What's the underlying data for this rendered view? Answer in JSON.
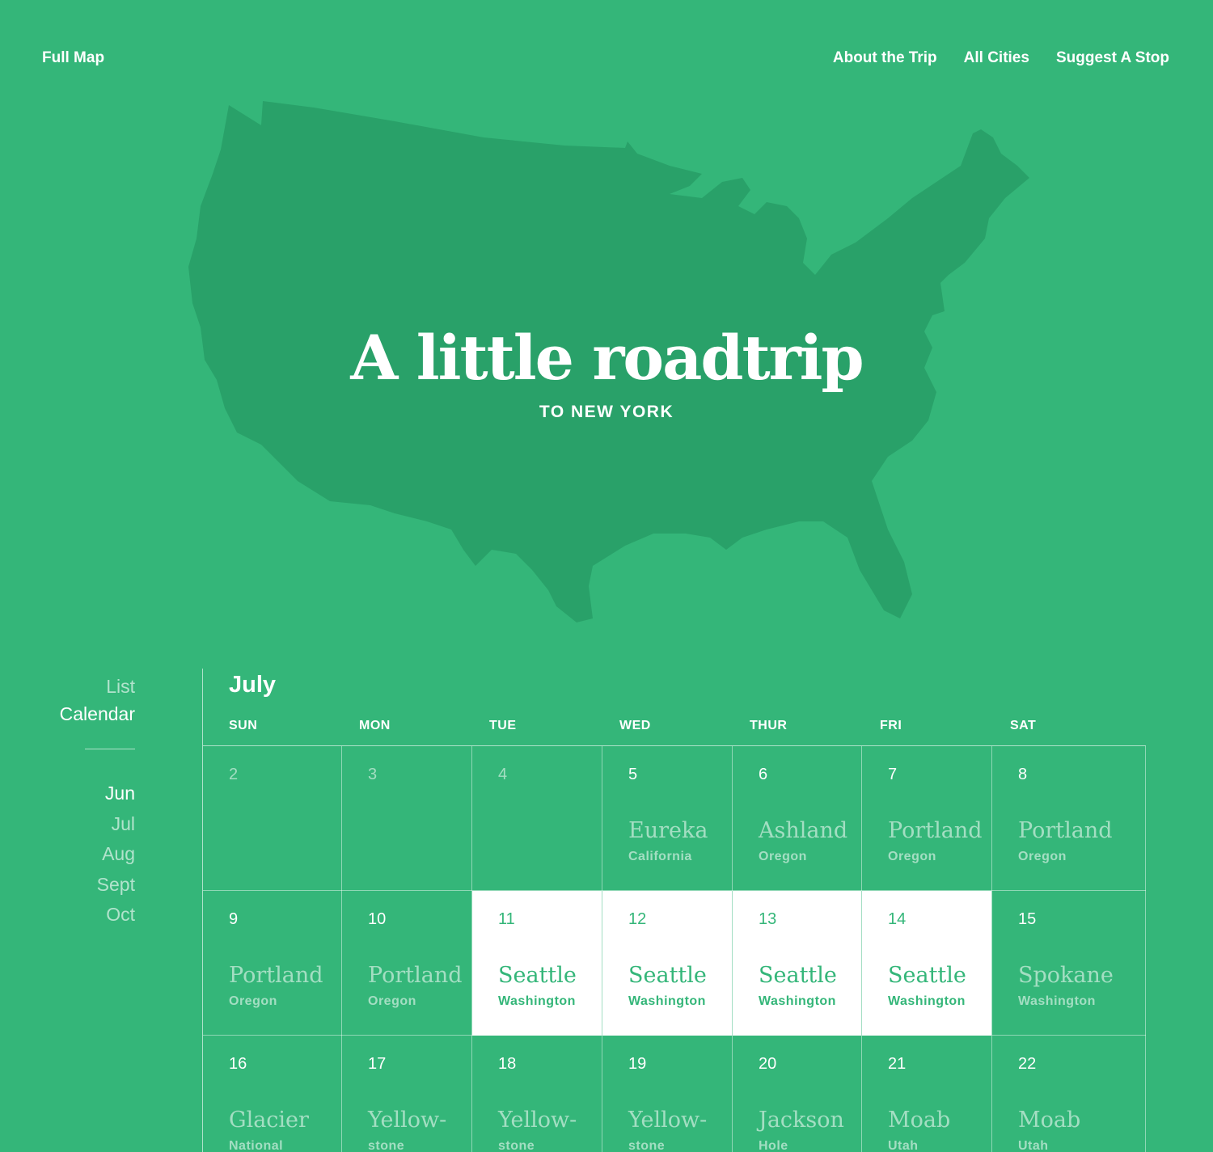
{
  "topnav": {
    "full_map": "Full Map",
    "about": "About the Trip",
    "cities": "All Cities",
    "suggest": "Suggest A Stop"
  },
  "hero": {
    "title": "A little roadtrip",
    "subtitle": "TO NEW YORK"
  },
  "colors": {
    "background": "#34b679",
    "map_fill": "#29a169",
    "highlight": "#ffffff"
  },
  "sidebar": {
    "views": [
      "List",
      "Calendar"
    ],
    "active_view": "Calendar",
    "months": [
      "Jun",
      "Jul",
      "Aug",
      "Sept",
      "Oct"
    ],
    "active_month": "Jun"
  },
  "calendar": {
    "month": "July",
    "weekdays": [
      "SUN",
      "MON",
      "TUE",
      "WED",
      "THUR",
      "FRI",
      "SAT"
    ],
    "weeks": [
      [
        {
          "day": "2",
          "city": "",
          "state": "",
          "muted": true
        },
        {
          "day": "3",
          "city": "",
          "state": "",
          "muted": true
        },
        {
          "day": "4",
          "city": "",
          "state": "",
          "muted": true
        },
        {
          "day": "5",
          "city": "Eureka",
          "state": "California"
        },
        {
          "day": "6",
          "city": "Ashland",
          "state": "Oregon"
        },
        {
          "day": "7",
          "city": "Portland",
          "state": "Oregon"
        },
        {
          "day": "8",
          "city": "Portland",
          "state": "Oregon"
        }
      ],
      [
        {
          "day": "9",
          "city": "Portland",
          "state": "Oregon"
        },
        {
          "day": "10",
          "city": "Portland",
          "state": "Oregon"
        },
        {
          "day": "11",
          "city": "Seattle",
          "state": "Washington",
          "highlight": true
        },
        {
          "day": "12",
          "city": "Seattle",
          "state": "Washington",
          "highlight": true
        },
        {
          "day": "13",
          "city": "Seattle",
          "state": "Washington",
          "highlight": true
        },
        {
          "day": "14",
          "city": "Seattle",
          "state": "Washington",
          "highlight": true
        },
        {
          "day": "15",
          "city": "Spokane",
          "state": "Washington"
        }
      ],
      [
        {
          "day": "16",
          "city": "Glacier",
          "state": "National"
        },
        {
          "day": "17",
          "city": "Yellow-",
          "state": "stone"
        },
        {
          "day": "18",
          "city": "Yellow-",
          "state": "stone"
        },
        {
          "day": "19",
          "city": "Yellow-",
          "state": "stone"
        },
        {
          "day": "20",
          "city": "Jackson",
          "state": "Hole"
        },
        {
          "day": "21",
          "city": "Moab",
          "state": "Utah"
        },
        {
          "day": "22",
          "city": "Moab",
          "state": "Utah"
        }
      ]
    ]
  }
}
